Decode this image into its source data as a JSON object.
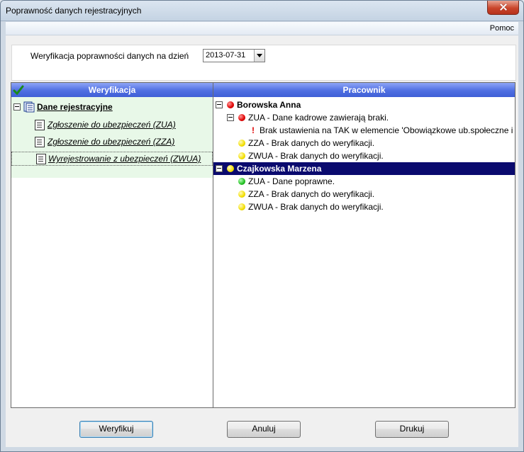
{
  "window": {
    "title": "Poprawność danych rejestracyjnych"
  },
  "menu": {
    "help": "Pomoc"
  },
  "date_filter": {
    "label": "Weryfikacja poprawności danych na dzień",
    "value": "2013-07-31"
  },
  "left_panel": {
    "header": "Weryfikacja",
    "root": "Dane rejestracyjne",
    "items": [
      "Zgłoszenie do ubezpieczeń (ZUA)",
      "Zgłoszenie do ubezpieczeń (ZZA)",
      "Wyrejestrowanie z ubezpieczeń (ZWUA)"
    ]
  },
  "right_panel": {
    "header": "Pracownik",
    "employees": [
      {
        "name": "Borowska Anna",
        "status": "red",
        "entries": [
          {
            "text": "ZUA - Dane kadrowe zawierają braki.",
            "status": "red",
            "detail": "Brak ustawienia na TAK w elemencie 'Obowiązkowe ub.społeczne i ."
          },
          {
            "text": "ZZA - Brak danych do weryfikacji.",
            "status": "yellow"
          },
          {
            "text": "ZWUA - Brak danych do weryfikacji.",
            "status": "yellow"
          }
        ]
      },
      {
        "name": "Czajkowska Marzena",
        "status": "yellow",
        "entries": [
          {
            "text": "ZUA - Dane poprawne.",
            "status": "green"
          },
          {
            "text": "ZZA - Brak danych do weryfikacji.",
            "status": "yellow"
          },
          {
            "text": "ZWUA - Brak danych do weryfikacji.",
            "status": "yellow"
          }
        ]
      }
    ]
  },
  "buttons": {
    "verify": "Weryfikuj",
    "cancel": "Anuluj",
    "print": "Drukuj"
  },
  "colors": {
    "header_blue": "#4f6fe2",
    "selection": "#0a0a6e",
    "left_highlight": "#e8f8e8"
  },
  "icons": {
    "check": "check-icon",
    "tree": "tree-icon",
    "document": "document-icon",
    "warning": "exclamation-icon"
  }
}
